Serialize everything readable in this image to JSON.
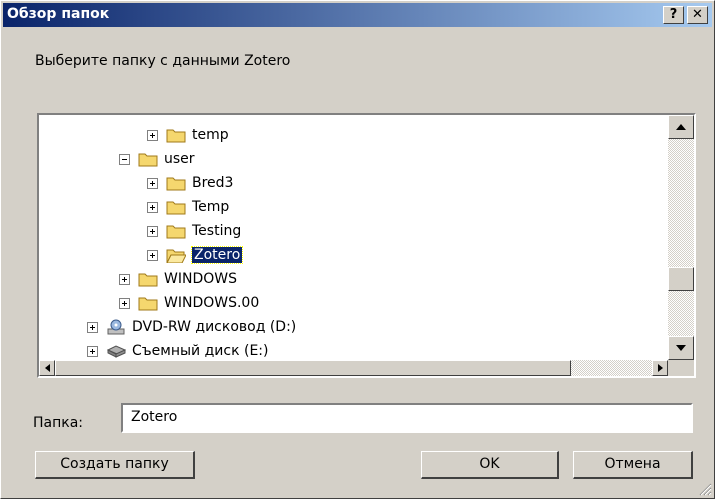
{
  "window": {
    "title": "Обзор папок",
    "help_glyph": "?",
    "close_glyph": "✕"
  },
  "prompt": "Выберите папку с данными Zotero",
  "tree": [
    {
      "label": "temp",
      "icon": "folder-icon",
      "expander": "plus"
    },
    {
      "label": "user",
      "icon": "folder-icon",
      "expander": "minus"
    },
    {
      "label": "Bred3",
      "icon": "folder-icon",
      "expander": "plus"
    },
    {
      "label": "Temp",
      "icon": "folder-icon",
      "expander": "plus"
    },
    {
      "label": "Testing",
      "icon": "folder-icon",
      "expander": "plus"
    },
    {
      "label": "Zotero",
      "icon": "open-folder-icon",
      "expander": "plus",
      "selected": true
    },
    {
      "label": "WINDOWS",
      "icon": "folder-icon",
      "expander": "plus"
    },
    {
      "label": "WINDOWS.00",
      "icon": "folder-icon",
      "expander": "plus"
    },
    {
      "label": "DVD-RW дисковод (D:)",
      "icon": "dvd-drive-icon",
      "expander": "plus"
    },
    {
      "label": "Съемный диск (E:)",
      "icon": "removable-disk-icon",
      "expander": "plus"
    }
  ],
  "folder_field": {
    "label": "Папка:",
    "value": "Zotero"
  },
  "buttons": {
    "new_folder": "Создать папку",
    "ok": "OK",
    "cancel": "Отмена"
  }
}
